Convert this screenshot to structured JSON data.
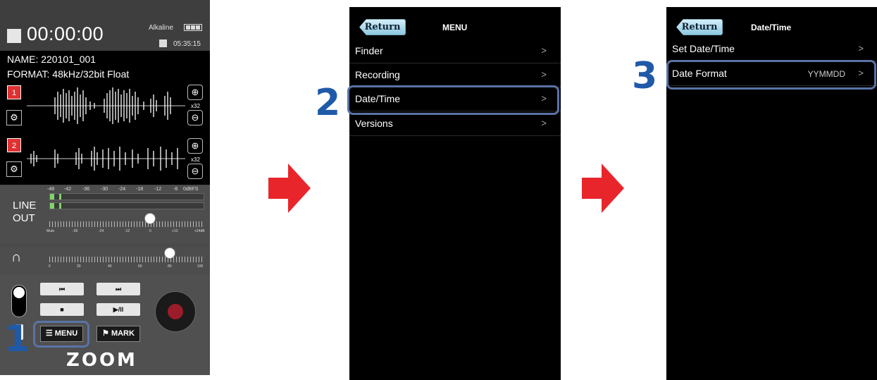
{
  "steps": [
    "1",
    "2",
    "3"
  ],
  "recorder": {
    "time": "00:00:00",
    "battery_label": "Alkaline",
    "remaining": "05:35:15",
    "name_label": "NAME:",
    "name_value": "220101_001",
    "format_label": "FORMAT:",
    "format_value": "48kHz/32bit Float",
    "tracks": [
      {
        "number": "1",
        "zoom": "x32"
      },
      {
        "number": "2",
        "zoom": "x32"
      }
    ],
    "meter_scale": [
      "-48",
      "-42",
      "-36",
      "-30",
      "-24",
      "-18",
      "-12",
      "-6",
      "0dBFS"
    ],
    "line_out_label": [
      "LINE",
      "OUT"
    ],
    "line_scale": [
      "Mute",
      "-36",
      "-24",
      "-12",
      "0",
      "+12",
      "+24dB"
    ],
    "phones_scale": [
      "0",
      "20",
      "40",
      "60",
      "80",
      "100"
    ],
    "buttons": {
      "rewind": "⏮",
      "forward": "⏭",
      "stop": "■",
      "play_pause": "▶/II",
      "menu": "MENU",
      "mark": "MARK"
    },
    "logo": "ZOOM"
  },
  "menu_screen": {
    "return_label": "Return",
    "title": "MENU",
    "items": [
      {
        "label": "Finder",
        "chevron": ">"
      },
      {
        "label": "Recording",
        "chevron": ">"
      },
      {
        "label": "Date/Time",
        "chevron": ">"
      },
      {
        "label": "Versions",
        "chevron": ">"
      }
    ]
  },
  "datetime_screen": {
    "return_label": "Return",
    "title": "Date/Time",
    "items": [
      {
        "label": "Set Date/Time",
        "value": "",
        "chevron": ">"
      },
      {
        "label": "Date Format",
        "value": "YYMMDD",
        "chevron": ">"
      }
    ]
  },
  "colors": {
    "step_blue": "#1f5aa8",
    "arrow_red": "#e8252b",
    "highlight": "#5a73a6"
  }
}
